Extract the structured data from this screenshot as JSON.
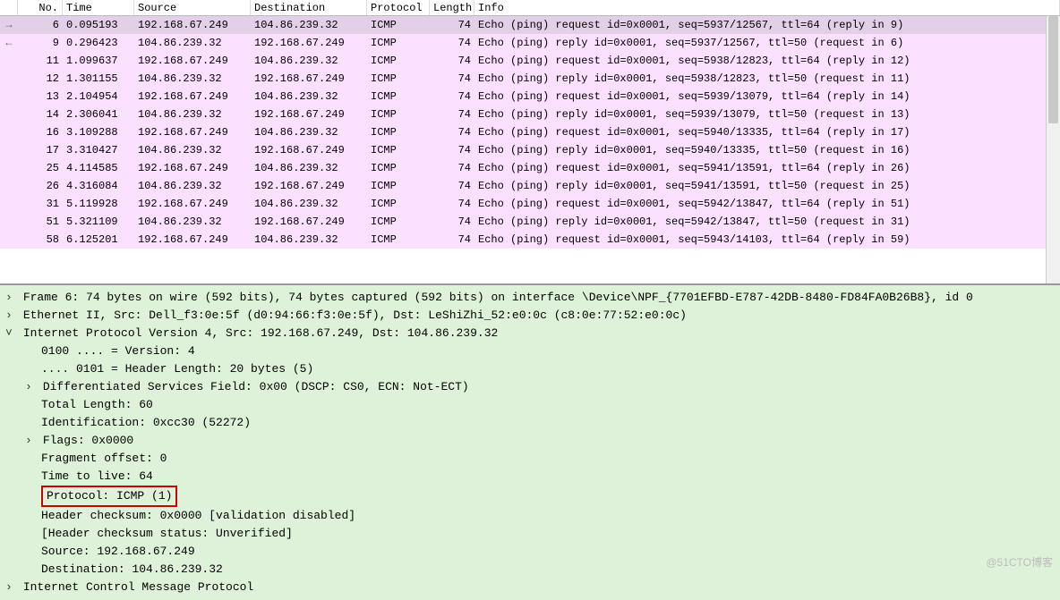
{
  "columns": {
    "no": "No.",
    "time": "Time",
    "source": "Source",
    "destination": "Destination",
    "protocol": "Protocol",
    "length": "Length",
    "info": "Info"
  },
  "packets": [
    {
      "arrow": "→",
      "no": "6",
      "time": "0.095193",
      "src": "192.168.67.249",
      "dst": "104.86.239.32",
      "proto": "ICMP",
      "len": "74",
      "info": "Echo (ping) request  id=0x0001, seq=5937/12567, ttl=64 (reply in 9)",
      "selected": true
    },
    {
      "arrow": "←",
      "no": "9",
      "time": "0.296423",
      "src": "104.86.239.32",
      "dst": "192.168.67.249",
      "proto": "ICMP",
      "len": "74",
      "info": "Echo (ping) reply    id=0x0001, seq=5937/12567, ttl=50 (request in 6)"
    },
    {
      "arrow": "",
      "no": "11",
      "time": "1.099637",
      "src": "192.168.67.249",
      "dst": "104.86.239.32",
      "proto": "ICMP",
      "len": "74",
      "info": "Echo (ping) request  id=0x0001, seq=5938/12823, ttl=64 (reply in 12)"
    },
    {
      "arrow": "",
      "no": "12",
      "time": "1.301155",
      "src": "104.86.239.32",
      "dst": "192.168.67.249",
      "proto": "ICMP",
      "len": "74",
      "info": "Echo (ping) reply    id=0x0001, seq=5938/12823, ttl=50 (request in 11)"
    },
    {
      "arrow": "",
      "no": "13",
      "time": "2.104954",
      "src": "192.168.67.249",
      "dst": "104.86.239.32",
      "proto": "ICMP",
      "len": "74",
      "info": "Echo (ping) request  id=0x0001, seq=5939/13079, ttl=64 (reply in 14)"
    },
    {
      "arrow": "",
      "no": "14",
      "time": "2.306041",
      "src": "104.86.239.32",
      "dst": "192.168.67.249",
      "proto": "ICMP",
      "len": "74",
      "info": "Echo (ping) reply    id=0x0001, seq=5939/13079, ttl=50 (request in 13)"
    },
    {
      "arrow": "",
      "no": "16",
      "time": "3.109288",
      "src": "192.168.67.249",
      "dst": "104.86.239.32",
      "proto": "ICMP",
      "len": "74",
      "info": "Echo (ping) request  id=0x0001, seq=5940/13335, ttl=64 (reply in 17)"
    },
    {
      "arrow": "",
      "no": "17",
      "time": "3.310427",
      "src": "104.86.239.32",
      "dst": "192.168.67.249",
      "proto": "ICMP",
      "len": "74",
      "info": "Echo (ping) reply    id=0x0001, seq=5940/13335, ttl=50 (request in 16)"
    },
    {
      "arrow": "",
      "no": "25",
      "time": "4.114585",
      "src": "192.168.67.249",
      "dst": "104.86.239.32",
      "proto": "ICMP",
      "len": "74",
      "info": "Echo (ping) request  id=0x0001, seq=5941/13591, ttl=64 (reply in 26)"
    },
    {
      "arrow": "",
      "no": "26",
      "time": "4.316084",
      "src": "104.86.239.32",
      "dst": "192.168.67.249",
      "proto": "ICMP",
      "len": "74",
      "info": "Echo (ping) reply    id=0x0001, seq=5941/13591, ttl=50 (request in 25)"
    },
    {
      "arrow": "",
      "no": "31",
      "time": "5.119928",
      "src": "192.168.67.249",
      "dst": "104.86.239.32",
      "proto": "ICMP",
      "len": "74",
      "info": "Echo (ping) request  id=0x0001, seq=5942/13847, ttl=64 (reply in 51)"
    },
    {
      "arrow": "",
      "no": "51",
      "time": "5.321109",
      "src": "104.86.239.32",
      "dst": "192.168.67.249",
      "proto": "ICMP",
      "len": "74",
      "info": "Echo (ping) reply    id=0x0001, seq=5942/13847, ttl=50 (request in 31)"
    },
    {
      "arrow": "",
      "no": "58",
      "time": "6.125201",
      "src": "192.168.67.249",
      "dst": "104.86.239.32",
      "proto": "ICMP",
      "len": "74",
      "info": "Echo (ping) request  id=0x0001, seq=5943/14103, ttl=64 (reply in 59)"
    }
  ],
  "details": {
    "frame": "Frame 6: 74 bytes on wire (592 bits), 74 bytes captured (592 bits) on interface \\Device\\NPF_{7701EFBD-E787-42DB-8480-FD84FA0B26B8}, id 0",
    "eth": "Ethernet II, Src: Dell_f3:0e:5f (d0:94:66:f3:0e:5f), Dst: LeShiZhi_52:e0:0c (c8:0e:77:52:e0:0c)",
    "ip": "Internet Protocol Version 4, Src: 192.168.67.249, Dst: 104.86.239.32",
    "ip_fields": {
      "version": "0100 .... = Version: 4",
      "hlen": ".... 0101 = Header Length: 20 bytes (5)",
      "dsf": "Differentiated Services Field: 0x00 (DSCP: CS0, ECN: Not-ECT)",
      "tlen": "Total Length: 60",
      "id": "Identification: 0xcc30 (52272)",
      "flags": "Flags: 0x0000",
      "frag": "Fragment offset: 0",
      "ttl": "Time to live: 64",
      "proto": "Protocol: ICMP (1)",
      "cksum": "Header checksum: 0x0000 [validation disabled]",
      "cksum_stat": "[Header checksum status: Unverified]",
      "src": "Source: 192.168.67.249",
      "dst": "Destination: 104.86.239.32"
    },
    "icmp": "Internet Control Message Protocol"
  },
  "watermark": "@51CTO博客"
}
